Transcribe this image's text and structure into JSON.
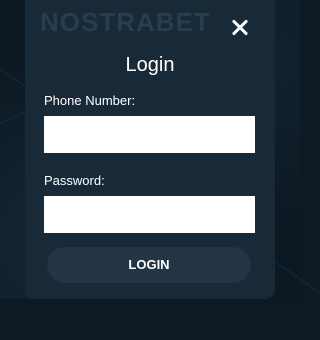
{
  "brand": {
    "logo_text": "NOSTRABET"
  },
  "modal": {
    "title": "Login",
    "close_icon": "close-icon"
  },
  "form": {
    "phone": {
      "label": "Phone Number:",
      "value": "",
      "placeholder": ""
    },
    "password": {
      "label": "Password:",
      "value": "",
      "placeholder": ""
    },
    "submit_label": "LOGIN"
  },
  "colors": {
    "page_background": "#0c1822",
    "modal_background": "#182a38",
    "button_background": "#233544",
    "text": "#ffffff",
    "input_background": "#ffffff"
  }
}
